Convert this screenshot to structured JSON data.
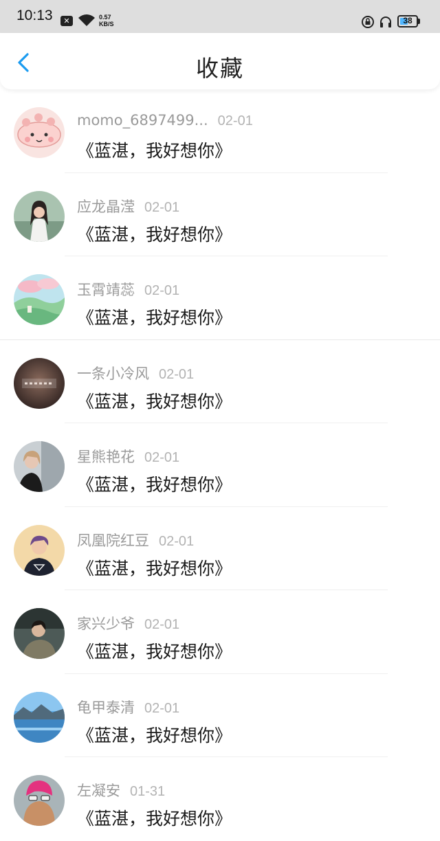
{
  "status_bar": {
    "time": "10:13",
    "speed_value": "0.57",
    "speed_unit": "KB/S",
    "battery": "38",
    "icons": [
      "notification-x-icon",
      "wifi-icon",
      "lock-rotation-icon",
      "headphones-icon",
      "battery-icon"
    ]
  },
  "header": {
    "title": "收藏",
    "back_icon": "chevron-left-icon",
    "accent_color": "#1a9bf0"
  },
  "items": [
    {
      "name": "momo_6897499...",
      "date": "02-01",
      "content": "《蓝湛，我好想你》"
    },
    {
      "name": "应龙晶滢",
      "date": "02-01",
      "content": "《蓝湛，我好想你》"
    },
    {
      "name": "玉霄靖蕊",
      "date": "02-01",
      "content": "《蓝湛，我好想你》"
    },
    {
      "name": "一条小冷风",
      "date": "02-01",
      "content": "《蓝湛，我好想你》"
    },
    {
      "name": "星熊艳花",
      "date": "02-01",
      "content": "《蓝湛，我好想你》"
    },
    {
      "name": "凤凰院红豆",
      "date": "02-01",
      "content": "《蓝湛，我好想你》"
    },
    {
      "name": "家兴少爷",
      "date": "02-01",
      "content": "《蓝湛，我好想你》"
    },
    {
      "name": "龟甲泰清",
      "date": "02-01",
      "content": "《蓝湛，我好想你》"
    },
    {
      "name": "左凝安",
      "date": "01-31",
      "content": "《蓝湛，我好想你》"
    }
  ]
}
